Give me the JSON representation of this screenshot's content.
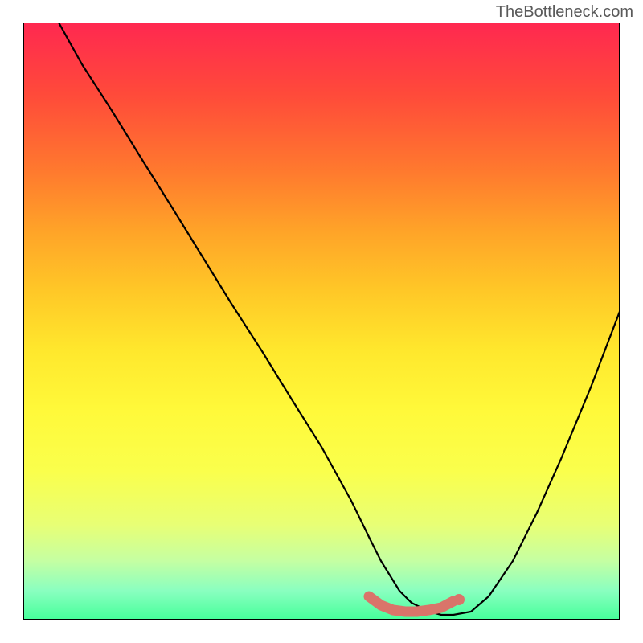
{
  "watermark": "TheBottleneck.com",
  "chart_data": {
    "type": "line",
    "title": "",
    "xlabel": "",
    "ylabel": "",
    "xlim": [
      0,
      100
    ],
    "ylim": [
      0,
      100
    ],
    "grid": false,
    "legend": false,
    "series": [
      {
        "name": "curve",
        "color": "#000000",
        "x": [
          6,
          10,
          15,
          20,
          25,
          30,
          35,
          40,
          45,
          50,
          55,
          58,
          60,
          63,
          65,
          68,
          70,
          72,
          75,
          78,
          82,
          86,
          90,
          95,
          100
        ],
        "y": [
          100,
          93,
          85,
          77,
          69,
          61,
          53,
          45,
          37,
          29,
          20,
          14,
          10,
          5,
          3,
          1.5,
          1,
          1,
          1.5,
          4,
          10,
          18,
          27,
          39,
          52
        ]
      },
      {
        "name": "highlight-band",
        "color": "#d9746a",
        "x": [
          58,
          60,
          62,
          64,
          66,
          68,
          70,
          72
        ],
        "y": [
          4,
          2.5,
          1.8,
          1.5,
          1.5,
          1.7,
          2.2,
          3.2
        ]
      }
    ],
    "markers": [
      {
        "name": "end-dot",
        "x": 73,
        "y": 3.5,
        "color": "#d9746a"
      }
    ],
    "colors": {
      "gradient_top": "#ff2850",
      "gradient_bottom": "#44ff99",
      "curve": "#000000",
      "highlight": "#d9746a"
    }
  }
}
